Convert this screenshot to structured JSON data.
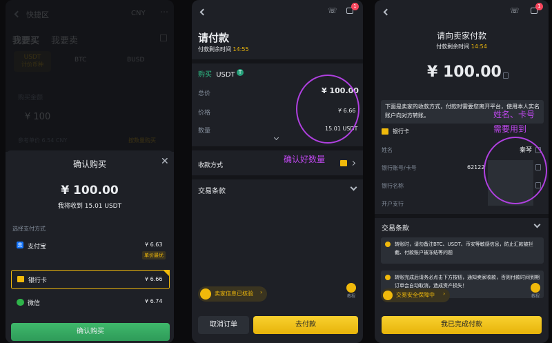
{
  "p1": {
    "header": {
      "title": "快捷区",
      "currency": "CNY"
    },
    "bg": {
      "tab_buy": "我要买",
      "tab_sell": "我要卖",
      "coins": [
        {
          "name": "USDT",
          "sub": "计价币种"
        },
        {
          "name": "BTC",
          "sub": ""
        },
        {
          "name": "BUSD",
          "sub": ""
        }
      ],
      "amount_label": "购买金额",
      "amount_value": "¥ 100",
      "ref_price": "参考单价 6.54 CNY",
      "order_by": "按数量购买"
    },
    "sheet": {
      "title": "确认购买",
      "amount": "¥ 100.00",
      "receive": "我将收到 15.01 USDT",
      "pay_method_label": "选择支付方式",
      "methods": [
        {
          "name": "支付宝",
          "price": "¥ 6.63",
          "badge": "单价最优"
        },
        {
          "name": "银行卡",
          "price": "¥ 6.66",
          "badge": ""
        },
        {
          "name": "微信",
          "price": "¥ 6.74",
          "badge": ""
        }
      ],
      "confirm_button": "确认购买"
    }
  },
  "p2": {
    "title": "请付款",
    "remaining_label": "付款剩余时间",
    "remaining_time": "14:55",
    "buy_label": "购买",
    "coin": "USDT",
    "rows": [
      {
        "label": "总价",
        "value": "¥ 100.00"
      },
      {
        "label": "价格",
        "value": "¥ 6.66"
      },
      {
        "label": "数量",
        "value": "15.01 USDT"
      }
    ],
    "pay_method_label": "收款方式",
    "terms_label": "交易条款",
    "seller_verified": "卖家信息已核验",
    "help_label": "教程",
    "cancel_button": "取消订单",
    "pay_button": "去付款",
    "annotation": "确认好数量",
    "notif_count": "1"
  },
  "p3": {
    "title": "请向卖家付款",
    "remaining_label": "付款剩余时间",
    "remaining_time": "14:54",
    "amount": "¥ 100.00",
    "notice": "下面是卖家的收款方式，付款时需要您离开平台，使用本人实名账户向对方转账。",
    "bank_label": "银行卡",
    "fields": [
      {
        "label": "姓名",
        "value": "秦琴"
      },
      {
        "label": "银行账号/卡号",
        "value": "62122"
      },
      {
        "label": "银行名称",
        "value": ""
      },
      {
        "label": "开户支行",
        "value": ""
      }
    ],
    "terms_label": "交易条款",
    "warn1": "转账时，请勿备注BTC、USDT、币安等敏感信息，防止汇款被拦截、付款账户被冻结等问题",
    "warn2": "转账完成后请务必点击下方按钮，通知卖家收款，否则付款时间到期订单会自动取消，造成资产损失！",
    "safety_label": "交易安全保障中",
    "help_label": "教程",
    "done_button": "我已完成付款",
    "annotation_line1": "姓名、卡号",
    "annotation_line2": "需要用到",
    "notif_count": "1"
  }
}
